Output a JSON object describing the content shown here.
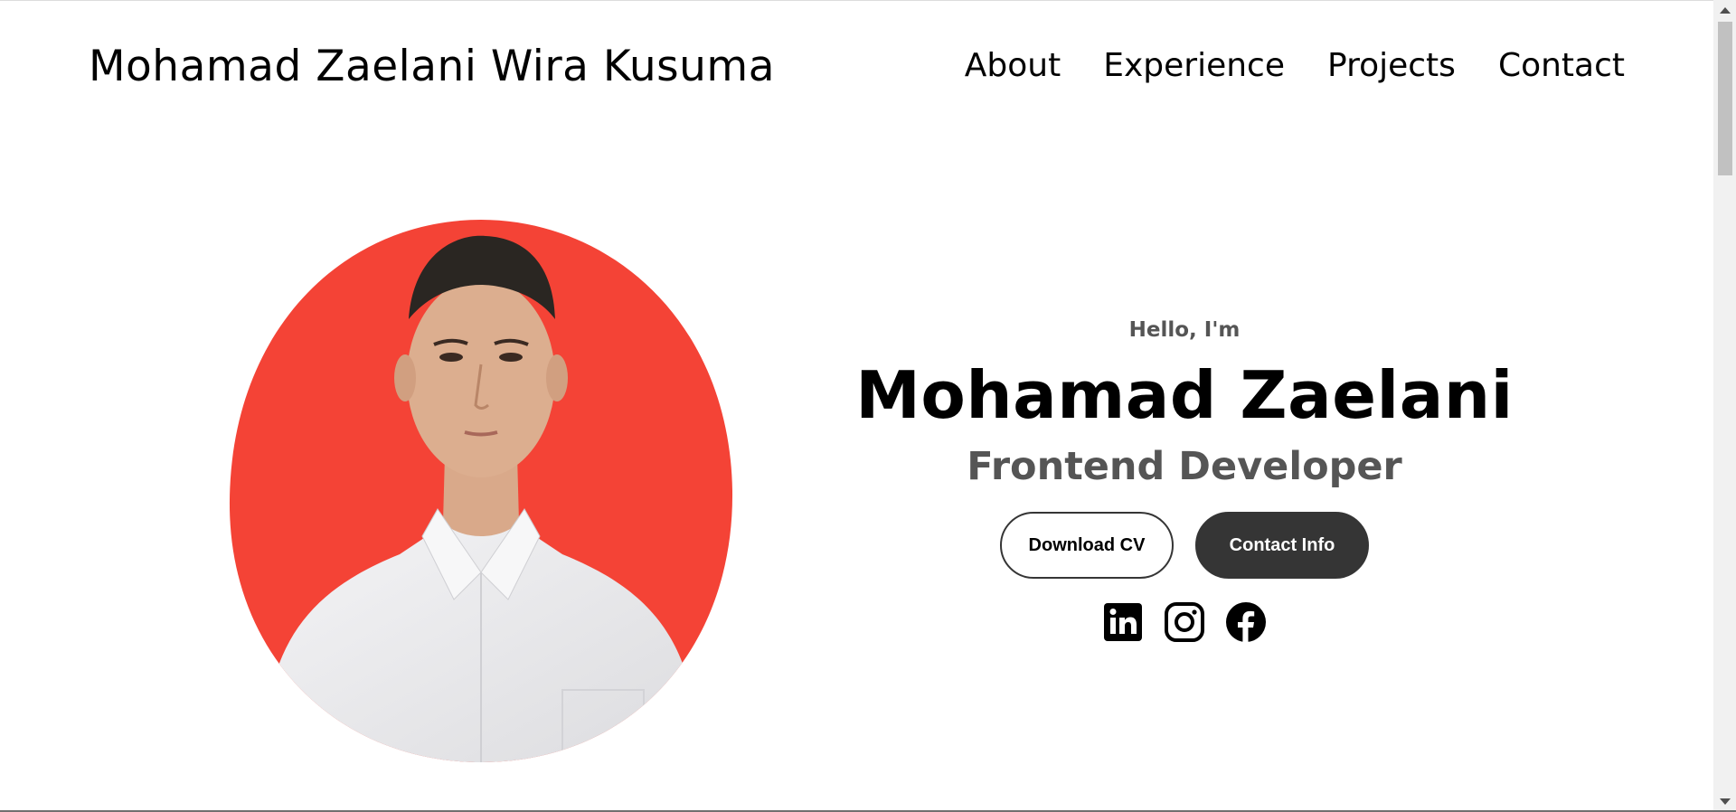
{
  "header": {
    "brand": "Mohamad Zaelani Wira Kusuma",
    "nav": [
      "About",
      "Experience",
      "Projects",
      "Contact"
    ]
  },
  "hero": {
    "greeting": "Hello, I'm",
    "name": "Mohamad Zaelani",
    "role": "Frontend Developer",
    "buttons": {
      "download_cv": "Download CV",
      "contact_info": "Contact Info"
    },
    "socials": [
      "linkedin-icon",
      "instagram-icon",
      "facebook-icon"
    ],
    "portrait_background_color": "#f44336"
  },
  "colors": {
    "text": "#000000",
    "muted": "#555555",
    "button_dark": "#353535"
  }
}
